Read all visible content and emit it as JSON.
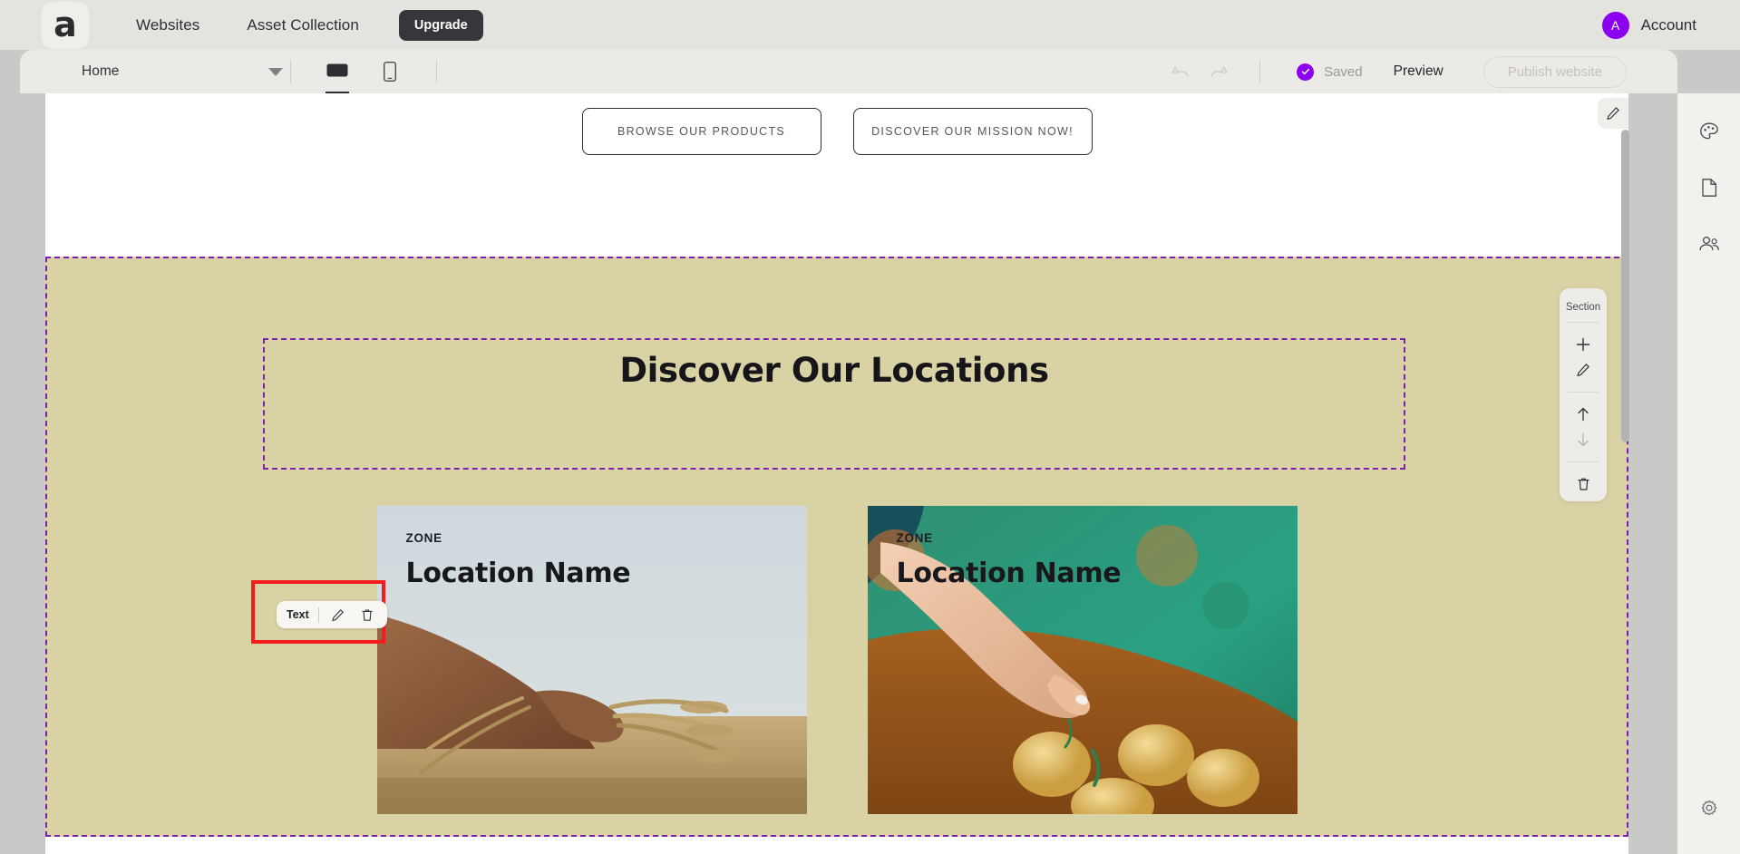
{
  "appbar": {
    "logo_glyph": "a",
    "nav": [
      {
        "label": "Websites"
      },
      {
        "label": "Asset Collection"
      }
    ],
    "upgrade_label": "Upgrade",
    "account": {
      "initial": "A",
      "label": "Account",
      "avatar_color": "#8c00f0"
    }
  },
  "toolbar": {
    "page_name": "Home",
    "devices": [
      {
        "name": "desktop",
        "active": true
      },
      {
        "name": "mobile",
        "active": false
      }
    ],
    "undo_label": "Undo",
    "redo_label": "Redo",
    "saved_label": "Saved",
    "preview_label": "Preview",
    "publish_label": "Publish website"
  },
  "canvas": {
    "hero_buttons": [
      {
        "label": "BROWSE OUR PRODUCTS"
      },
      {
        "label": "DISCOVER OUR MISSION NOW!"
      }
    ],
    "section_heading": "Discover Our Locations",
    "cards": [
      {
        "zone": "ZONE",
        "name": "Location Name",
        "image": "hand-holding-wheat-in-field"
      },
      {
        "zone": "ZONE",
        "name": "Location Name",
        "image": "hand-reaching-potatoes-in-soil"
      }
    ],
    "section_bg": "#d9d2a4",
    "selection_outline_color": "#7d1fb0",
    "highlight_color": "#f41d1d"
  },
  "widget_toolbar": {
    "label": "Text",
    "edit_label": "Edit",
    "delete_label": "Delete"
  },
  "section_panel": {
    "title": "Section",
    "actions": [
      {
        "name": "add",
        "label": "Add section",
        "disabled": false
      },
      {
        "name": "edit",
        "label": "Edit section",
        "disabled": false
      },
      {
        "name": "move-up",
        "label": "Move up",
        "disabled": false
      },
      {
        "name": "move-down",
        "label": "Move down",
        "disabled": true
      },
      {
        "name": "delete",
        "label": "Delete section",
        "disabled": false
      }
    ]
  },
  "right_rail": {
    "items": [
      {
        "name": "design",
        "label": "Design"
      },
      {
        "name": "pages",
        "label": "Pages"
      },
      {
        "name": "audience",
        "label": "Audience"
      },
      {
        "name": "settings",
        "label": "Settings"
      }
    ]
  }
}
